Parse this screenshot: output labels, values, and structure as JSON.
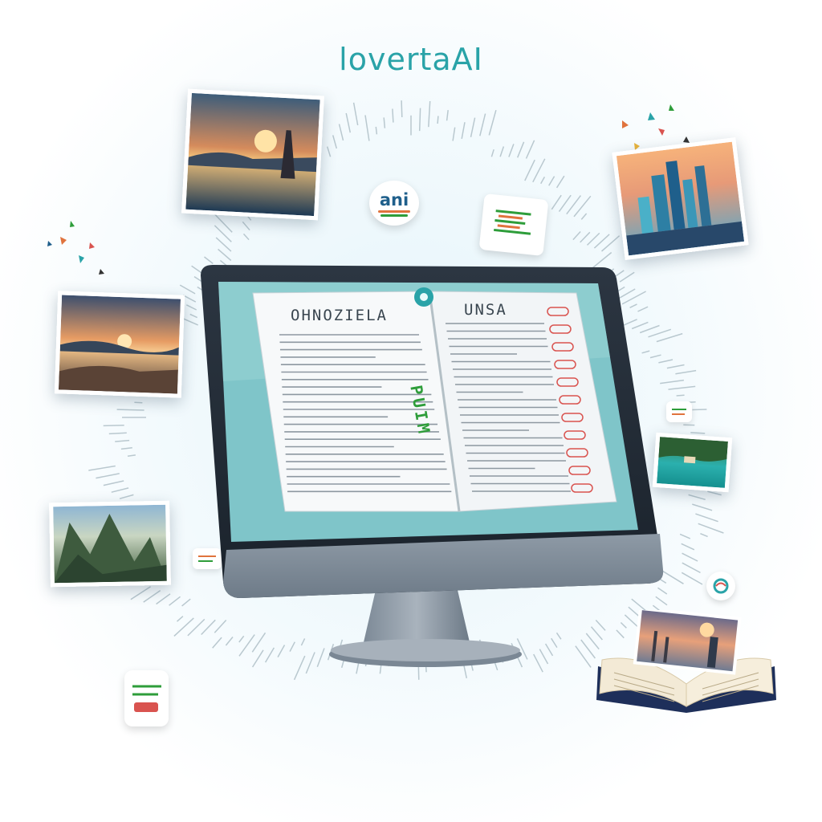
{
  "brand": {
    "title": "lovertaAI"
  },
  "monitor": {
    "book": {
      "left_heading": "OHNOZIELA",
      "right_heading": "UNSA",
      "spine_label": "PUIM"
    }
  },
  "badges": {
    "top_badge": "ani"
  },
  "colors": {
    "accent": "#2aa3a8",
    "screen": "#7fc5c9",
    "bezel": "#1f2a35",
    "green": "#2e9d3a",
    "red": "#d9534f"
  },
  "icons": [
    "sunset-photo-icon",
    "city-photo-icon",
    "beach-photo-icon",
    "mountain-photo-icon",
    "lagoon-photo-icon",
    "open-book-icon"
  ]
}
